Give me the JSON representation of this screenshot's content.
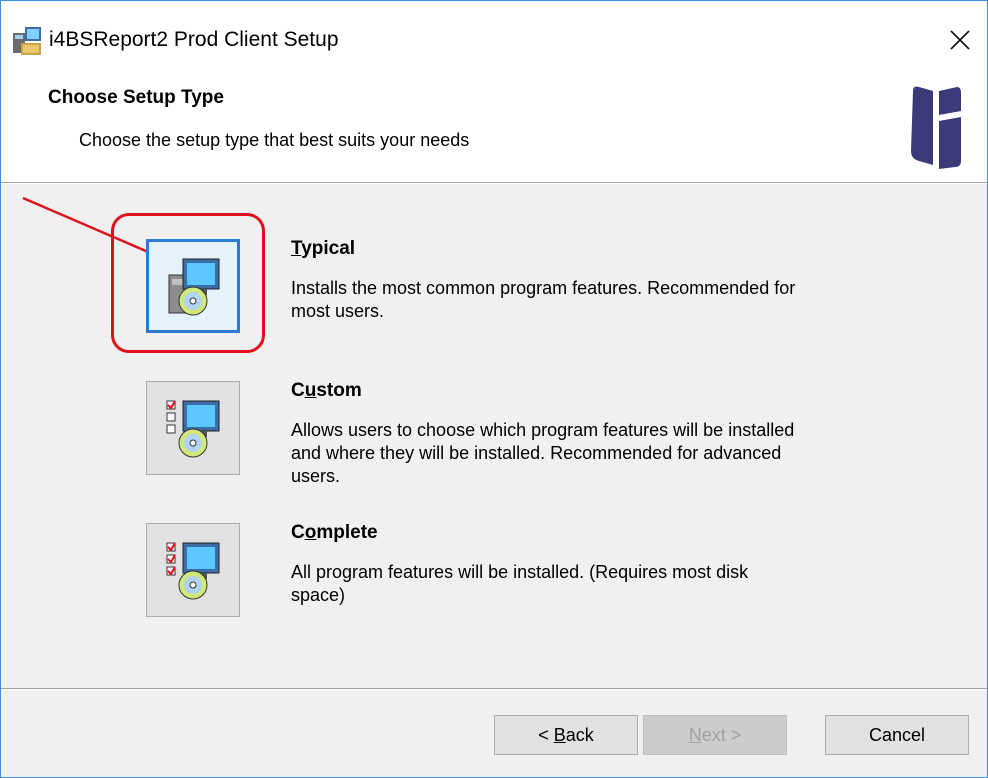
{
  "window": {
    "title": "i4BSReport2 Prod Client Setup",
    "close_label": "✕"
  },
  "header": {
    "title": "Choose Setup Type",
    "subtitle": "Choose the setup type that best suits your needs"
  },
  "options": [
    {
      "mnemonic": "T",
      "label_rest": "ypical",
      "description_line1": "Installs the most common program features. Recommended for",
      "description_line2": "most users.",
      "selected": true
    },
    {
      "label_pre": "C",
      "mnemonic": "u",
      "label_rest": "stom",
      "description_line1": "Allows users to choose which program features will be installed",
      "description_line2": "and where they will be installed. Recommended for advanced",
      "description_line3": "users.",
      "selected": false
    },
    {
      "label_pre": "C",
      "mnemonic": "o",
      "label_rest": "mplete",
      "description_line1": "All program features will be installed.  (Requires most disk",
      "description_line2": "space)",
      "selected": false
    }
  ],
  "buttons": {
    "back_pre": "< ",
    "back_mnemonic": "B",
    "back_rest": "ack",
    "next_mnemonic": "N",
    "next_rest": "ext >",
    "cancel": "Cancel"
  },
  "colors": {
    "accent": "#2b7ad0",
    "annotation": "#e0101c",
    "brand": "#3c3a78"
  }
}
